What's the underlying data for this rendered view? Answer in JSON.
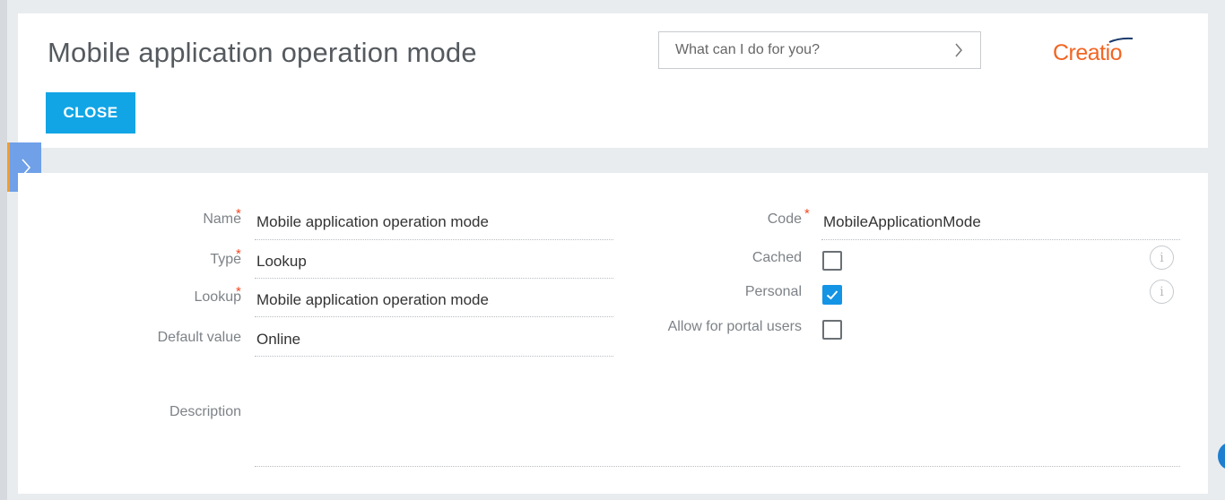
{
  "header": {
    "title": "Mobile application operation mode",
    "search_placeholder": "What can I do for you?",
    "logo_text": "Creatio",
    "close_label": "CLOSE"
  },
  "form": {
    "name": {
      "label": "Name",
      "value": "Mobile application operation mode",
      "required": true
    },
    "type": {
      "label": "Type",
      "value": "Lookup",
      "required": true
    },
    "lookup": {
      "label": "Lookup",
      "value": "Mobile application operation mode",
      "required": true
    },
    "default_value": {
      "label": "Default value",
      "value": "Online",
      "required": false
    },
    "description": {
      "label": "Description",
      "value": ""
    },
    "code": {
      "label": "Code",
      "value": "MobileApplicationMode",
      "required": true
    },
    "cached": {
      "label": "Cached",
      "checked": false
    },
    "personal": {
      "label": "Personal",
      "checked": true
    },
    "portal": {
      "label": "Allow for portal users",
      "checked": false
    }
  },
  "colors": {
    "accent": "#12a5e5",
    "brand": "#f26522",
    "required": "#f04a24",
    "checkbox_checked": "#1394e5"
  },
  "icons": {
    "search_submit": "chevron-right-icon",
    "side_toggle": "chevron-right-icon",
    "info": "info-icon",
    "check": "check-icon"
  }
}
